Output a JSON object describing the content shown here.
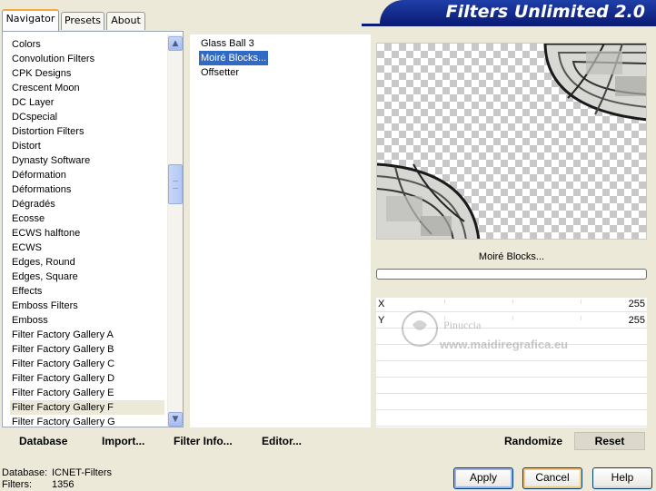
{
  "tabs": [
    {
      "label": "Navigator",
      "active": true
    },
    {
      "label": "Presets",
      "active": false
    },
    {
      "label": "About",
      "active": false
    }
  ],
  "app_title": "Filters Unlimited 2.0",
  "categories": [
    "Colors",
    "Convolution Filters",
    "CPK Designs",
    "Crescent Moon",
    "DC Layer",
    "DCspecial",
    "Distortion Filters",
    "Distort",
    "Dynasty Software",
    "Déformation",
    "Déformations",
    "Dégradés",
    "Ecosse",
    "ECWS halftone",
    "ECWS",
    "Edges, Round",
    "Edges, Square",
    "Effects",
    "Emboss Filters",
    "Emboss",
    "Filter Factory Gallery A",
    "Filter Factory Gallery B",
    "Filter Factory Gallery C",
    "Filter Factory Gallery D",
    "Filter Factory Gallery E",
    "Filter Factory Gallery F",
    "Filter Factory Gallery G"
  ],
  "selected_category": "Filter Factory Gallery F",
  "filters": [
    "Glass Ball 3",
    "Moiré Blocks...",
    "Offsetter"
  ],
  "selected_filter": "Moiré Blocks...",
  "left_buttons": {
    "database": "Database",
    "import": "Import...",
    "filter_info": "Filter Info...",
    "editor": "Editor..."
  },
  "current_filter_name": "Moiré Blocks...",
  "params": [
    {
      "label": "X",
      "value": "255"
    },
    {
      "label": "Y",
      "value": "255"
    }
  ],
  "right_buttons": {
    "randomize": "Randomize",
    "reset": "Reset"
  },
  "status": {
    "database_label": "Database:",
    "database_value": "ICNET-Filters",
    "filters_label": "Filters:",
    "filters_value": "1356"
  },
  "dialog_buttons": {
    "apply": "Apply",
    "cancel": "Cancel",
    "help": "Help"
  },
  "watermark": {
    "line1": "Pinuccia",
    "line2": "www.maidiregrafica.eu"
  },
  "colors": {
    "banner": "#0b1d78",
    "selection": "#316ac5",
    "face": "#ece9d8"
  }
}
